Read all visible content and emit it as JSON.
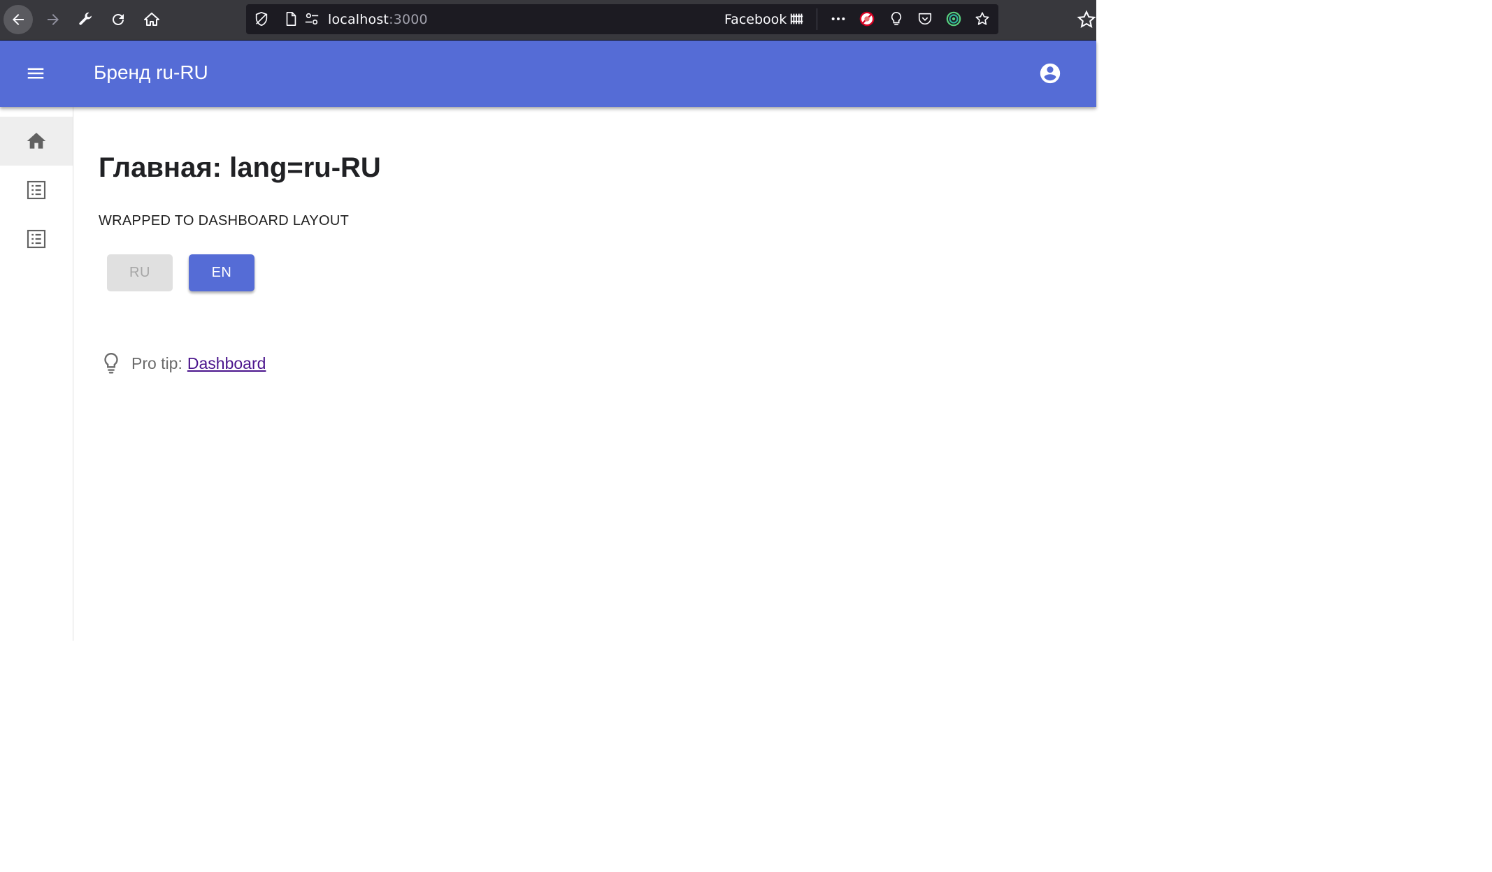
{
  "browser": {
    "url_host": "localhost",
    "url_port": ":3000",
    "bookmark_label": "Facebook",
    "icons": [
      "back-arrow-icon",
      "forward-arrow-icon",
      "wrench-icon",
      "reload-icon",
      "home-icon",
      "tracking-shield-icon",
      "page-icon",
      "permissions-icon",
      "facebook-container-icon",
      "more-icon",
      "blocked-extension-icon",
      "lightbulb-icon",
      "pocket-icon",
      "target-extension-icon",
      "bookmark-star-icon"
    ]
  },
  "appbar": {
    "brand": "Бренд ru-RU",
    "color": "#556cd6"
  },
  "sidebar": {
    "items": [
      {
        "icon": "home-icon",
        "selected": true
      },
      {
        "icon": "list-icon",
        "selected": false
      },
      {
        "icon": "list-icon",
        "selected": false
      }
    ]
  },
  "main": {
    "title": "Главная: lang=ru-RU",
    "subtitle": "WRAPPED TO DASHBOARD LAYOUT",
    "buttons": [
      {
        "label": "RU",
        "disabled": true
      },
      {
        "label": "EN",
        "disabled": false
      }
    ],
    "tip": {
      "prefix": "Pro tip:",
      "link": "Dashboard",
      "link_color": "#4a148c"
    }
  }
}
